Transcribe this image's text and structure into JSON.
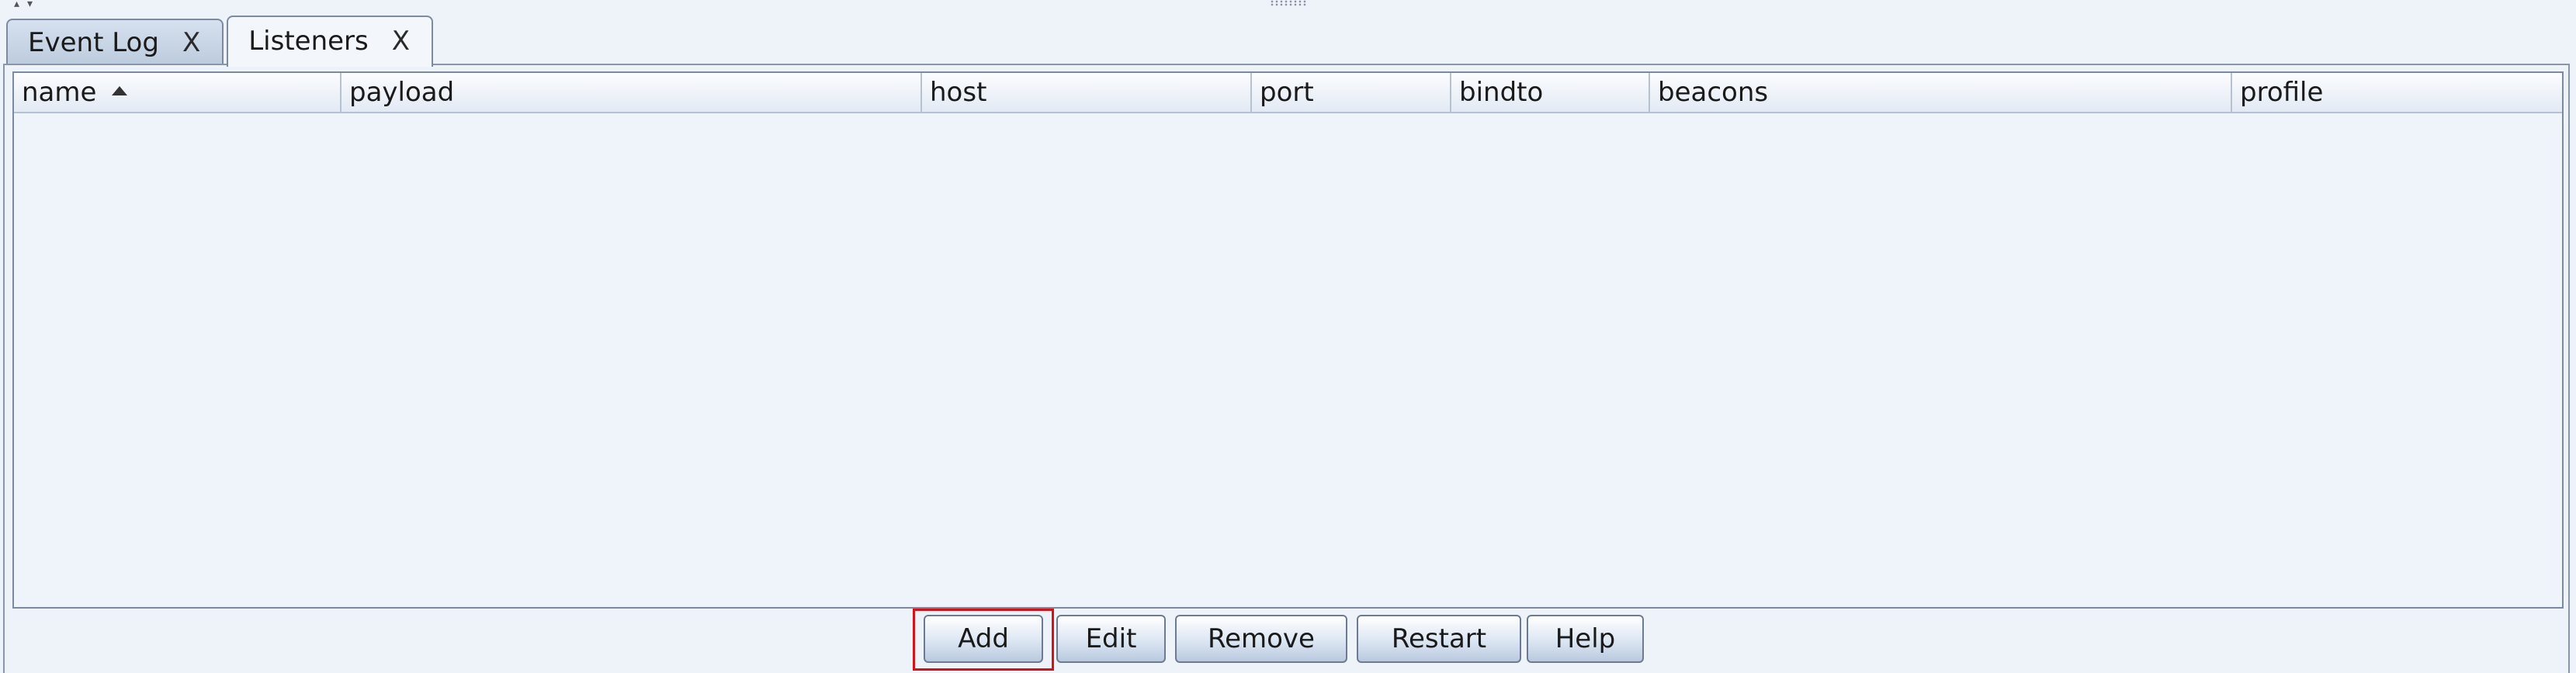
{
  "tabs": [
    {
      "label": "Event Log",
      "close": "X",
      "active": false
    },
    {
      "label": "Listeners",
      "close": "X",
      "active": true
    }
  ],
  "table": {
    "columns": [
      {
        "label": "name",
        "sorted": "ascending"
      },
      {
        "label": "payload"
      },
      {
        "label": "host"
      },
      {
        "label": "port"
      },
      {
        "label": "bindto"
      },
      {
        "label": "beacons"
      },
      {
        "label": "profile"
      }
    ],
    "rows": []
  },
  "buttons": {
    "add": "Add",
    "edit": "Edit",
    "remove": "Remove",
    "restart": "Restart",
    "help": "Help"
  },
  "highlighted_button": "add",
  "colors": {
    "highlight": "#d3121a",
    "background": "#eef2f9"
  }
}
